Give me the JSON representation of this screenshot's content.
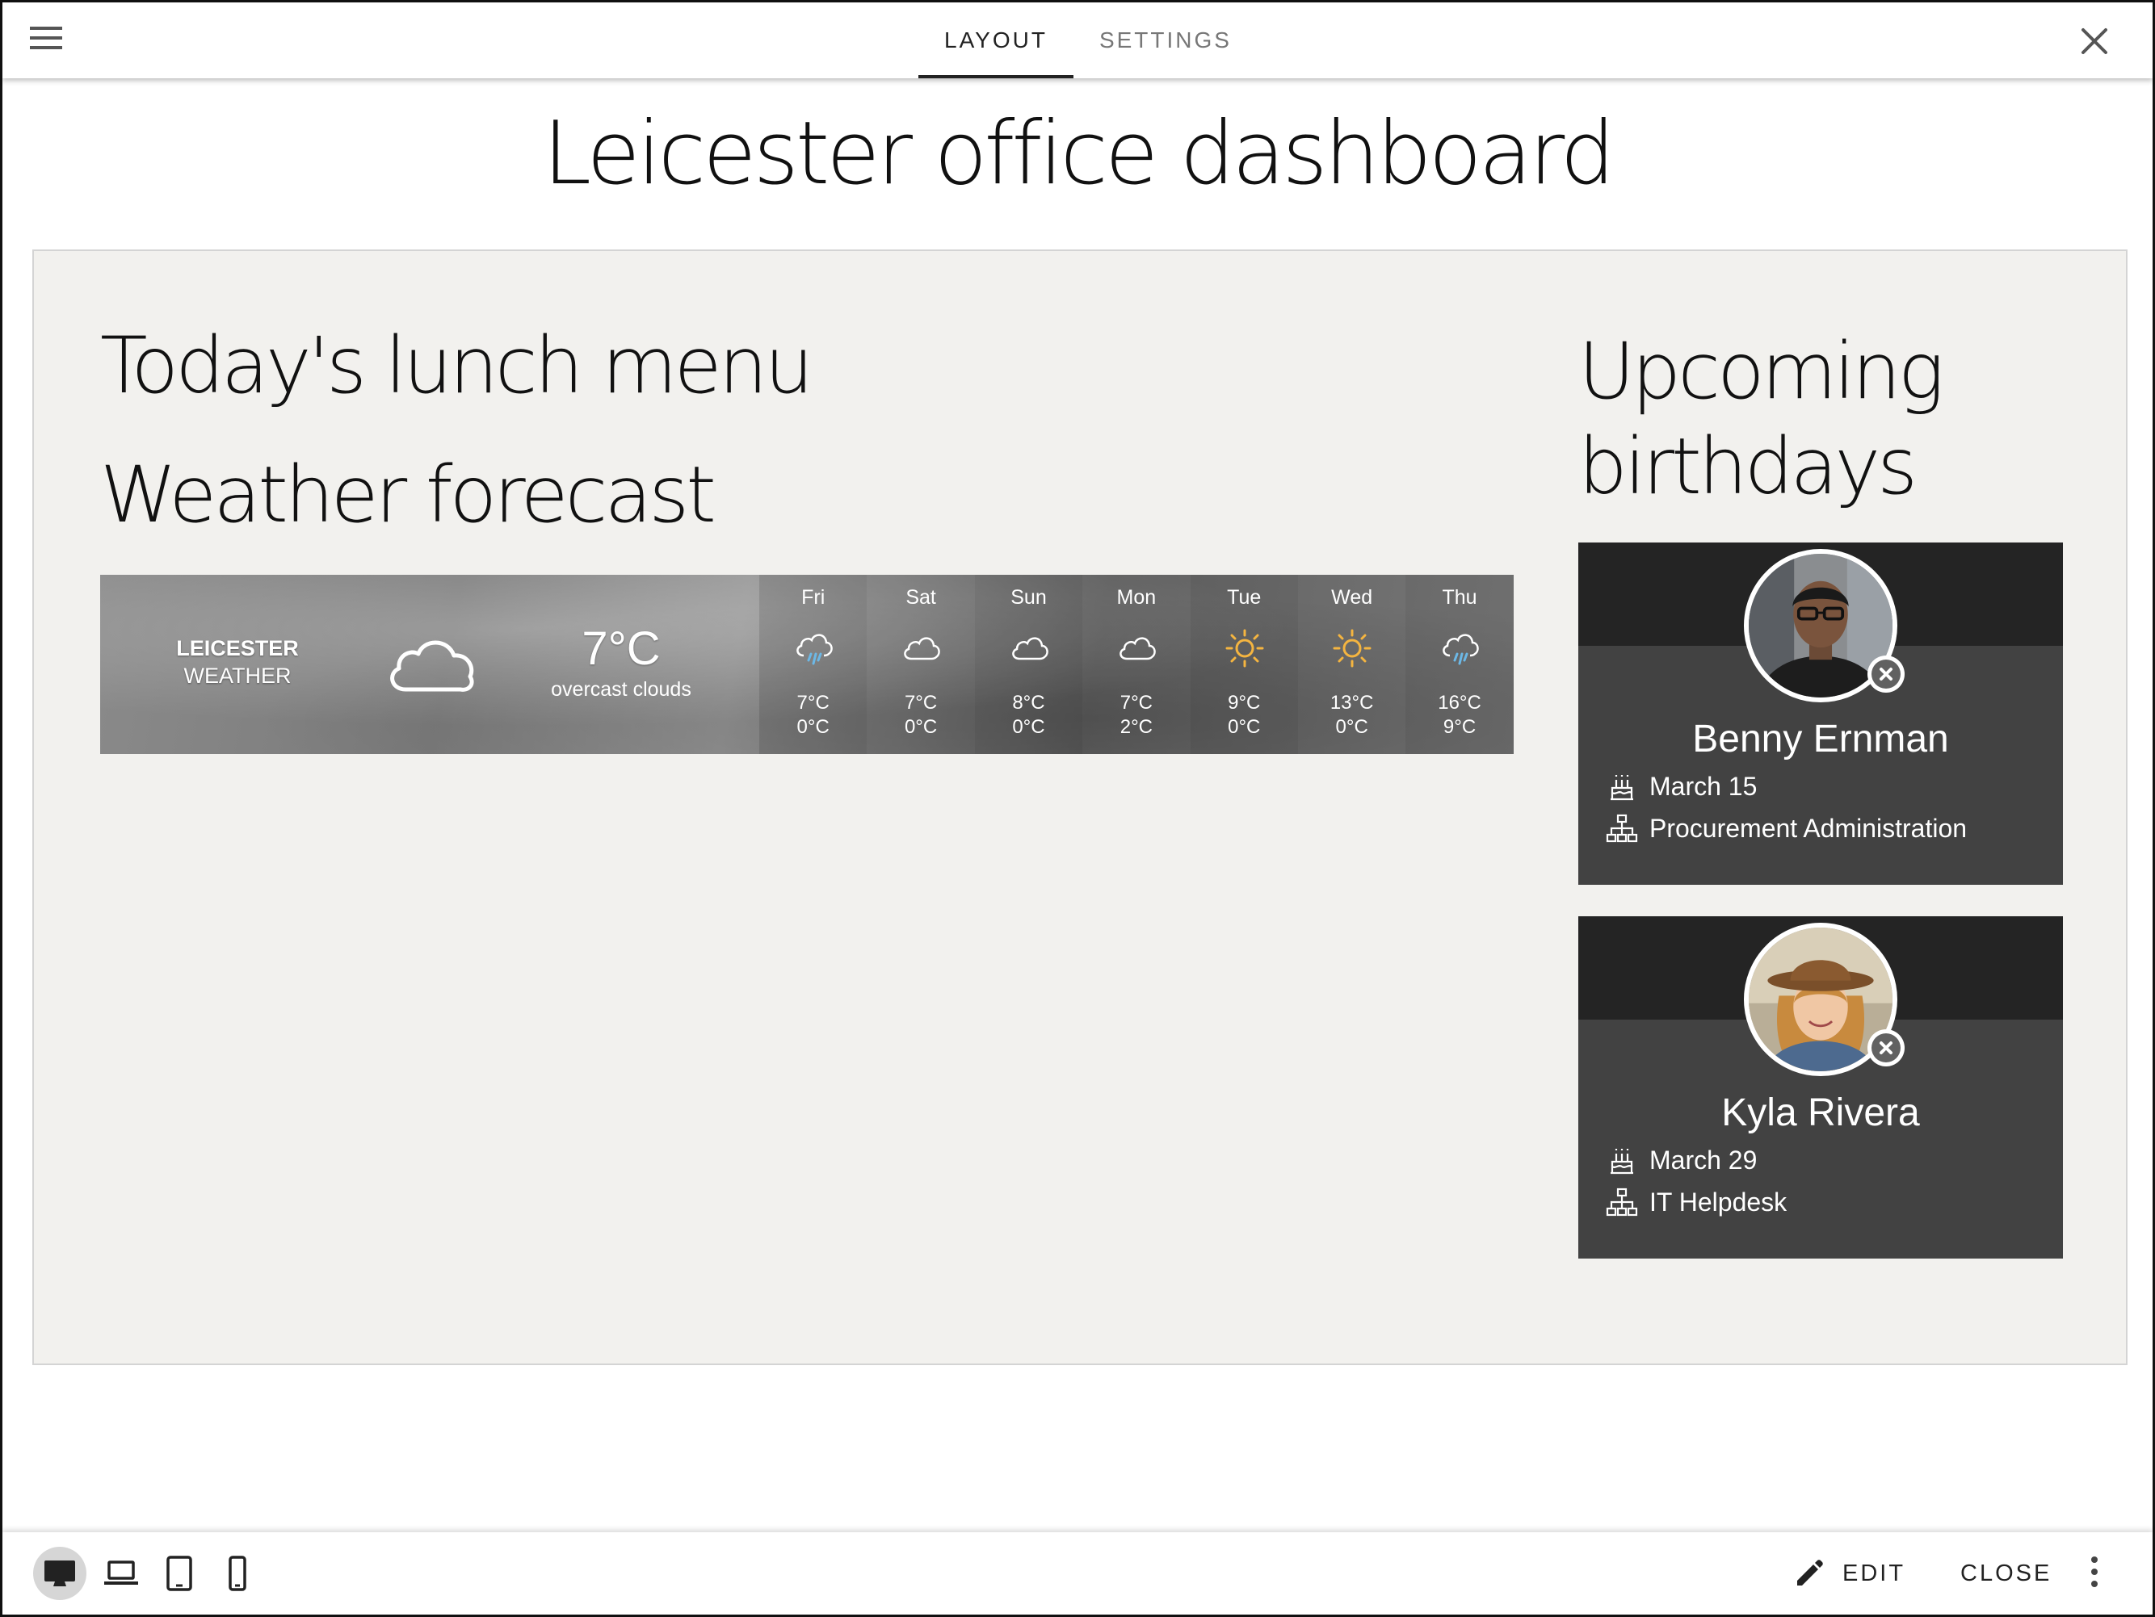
{
  "header": {
    "tabs": [
      {
        "label": "LAYOUT",
        "active": true
      },
      {
        "label": "SETTINGS",
        "active": false
      }
    ],
    "menu_icon": "hamburger-menu-icon",
    "close_icon": "close-icon"
  },
  "page": {
    "title": "Leicester office dashboard"
  },
  "sections": {
    "lunch_title": "Today's lunch menu",
    "weather_title": "Weather forecast",
    "birthdays_title": "Upcoming birthdays"
  },
  "weather": {
    "city_line1": "LEICESTER",
    "city_line2": "WEATHER",
    "current_temp": "7°C",
    "current_desc": "overcast clouds",
    "current_icon": "cloud-icon",
    "days": [
      {
        "name": "Fri",
        "icon": "rain-icon",
        "hi": "7°C",
        "lo": "0°C"
      },
      {
        "name": "Sat",
        "icon": "cloud-icon",
        "hi": "7°C",
        "lo": "0°C"
      },
      {
        "name": "Sun",
        "icon": "cloud-icon",
        "hi": "8°C",
        "lo": "0°C"
      },
      {
        "name": "Mon",
        "icon": "cloud-icon",
        "hi": "7°C",
        "lo": "2°C"
      },
      {
        "name": "Tue",
        "icon": "sun-icon",
        "hi": "9°C",
        "lo": "0°C"
      },
      {
        "name": "Wed",
        "icon": "sun-icon",
        "hi": "13°C",
        "lo": "0°C"
      },
      {
        "name": "Thu",
        "icon": "rain-icon",
        "hi": "16°C",
        "lo": "9°C"
      }
    ],
    "colors": {
      "sun": "#f5b540",
      "rain_drop": "#6cb8e6"
    }
  },
  "birthdays": [
    {
      "name": "Benny Ernman",
      "date": "March 15",
      "department": "Procurement Administration"
    },
    {
      "name": "Kyla Rivera",
      "date": "March 29",
      "department": "IT Helpdesk"
    }
  ],
  "footer": {
    "devices": [
      {
        "icon": "desktop-icon",
        "active": true
      },
      {
        "icon": "laptop-icon",
        "active": false
      },
      {
        "icon": "tablet-icon",
        "active": false
      },
      {
        "icon": "phone-icon",
        "active": false
      }
    ],
    "edit_label": "EDIT",
    "close_label": "CLOSE"
  }
}
